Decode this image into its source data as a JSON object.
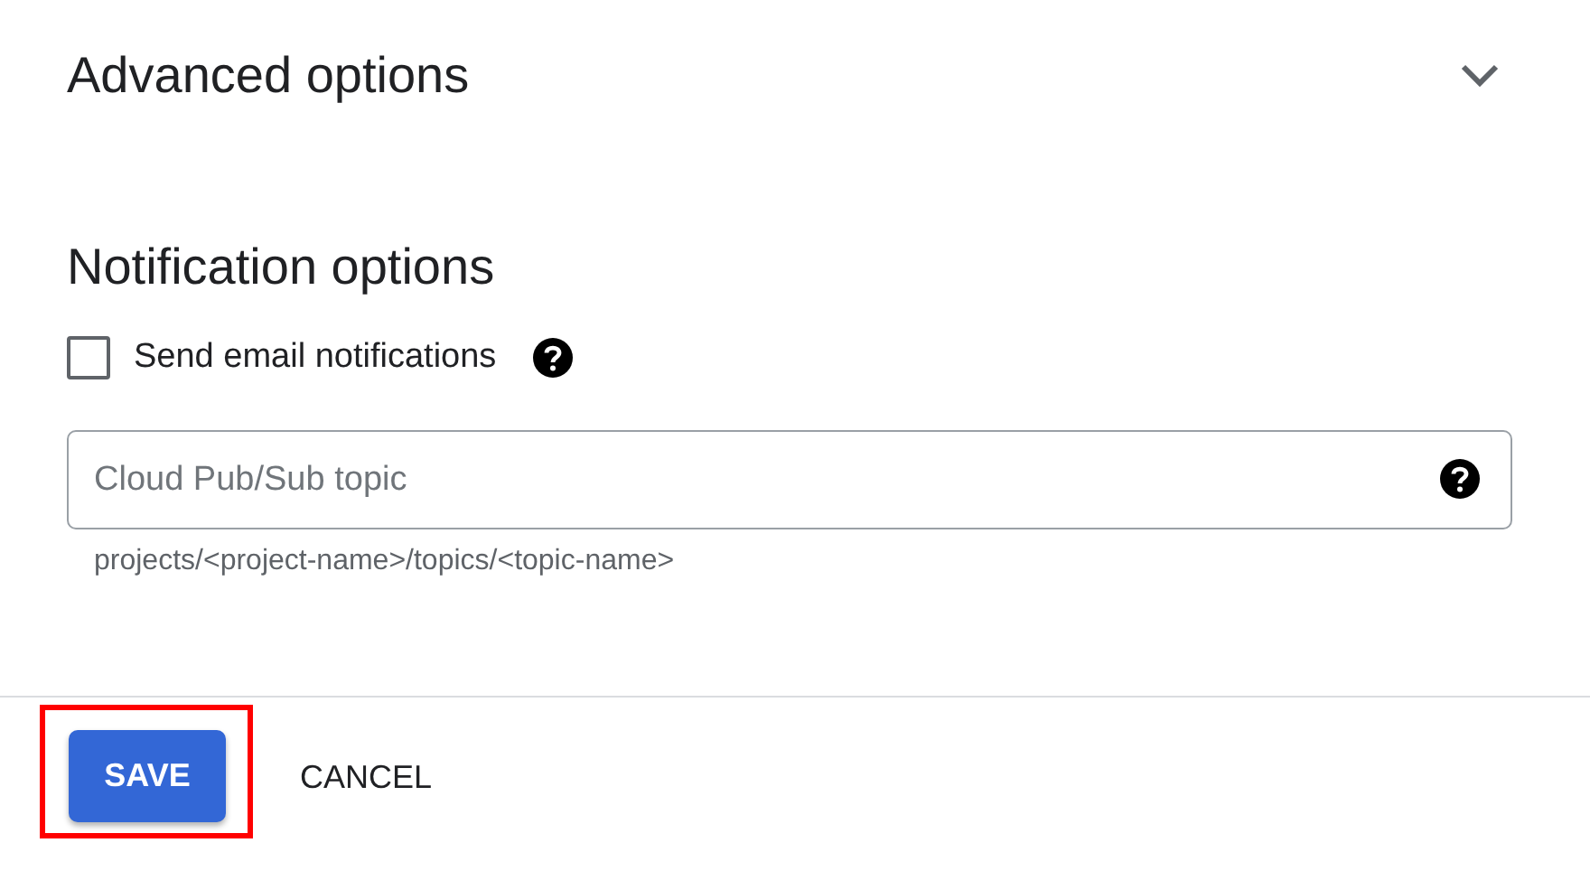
{
  "advanced": {
    "title": "Advanced options",
    "expanded": false
  },
  "notification": {
    "title": "Notification options",
    "email_checkbox": {
      "label": "Send email notifications",
      "checked": false
    },
    "topic_field": {
      "placeholder": "Cloud Pub/Sub topic",
      "hint": "projects/<project-name>/topics/<topic-name>"
    }
  },
  "footer": {
    "save": {
      "label": "SAVE",
      "highlighted": true
    },
    "cancel": {
      "label": "CANCEL"
    }
  }
}
